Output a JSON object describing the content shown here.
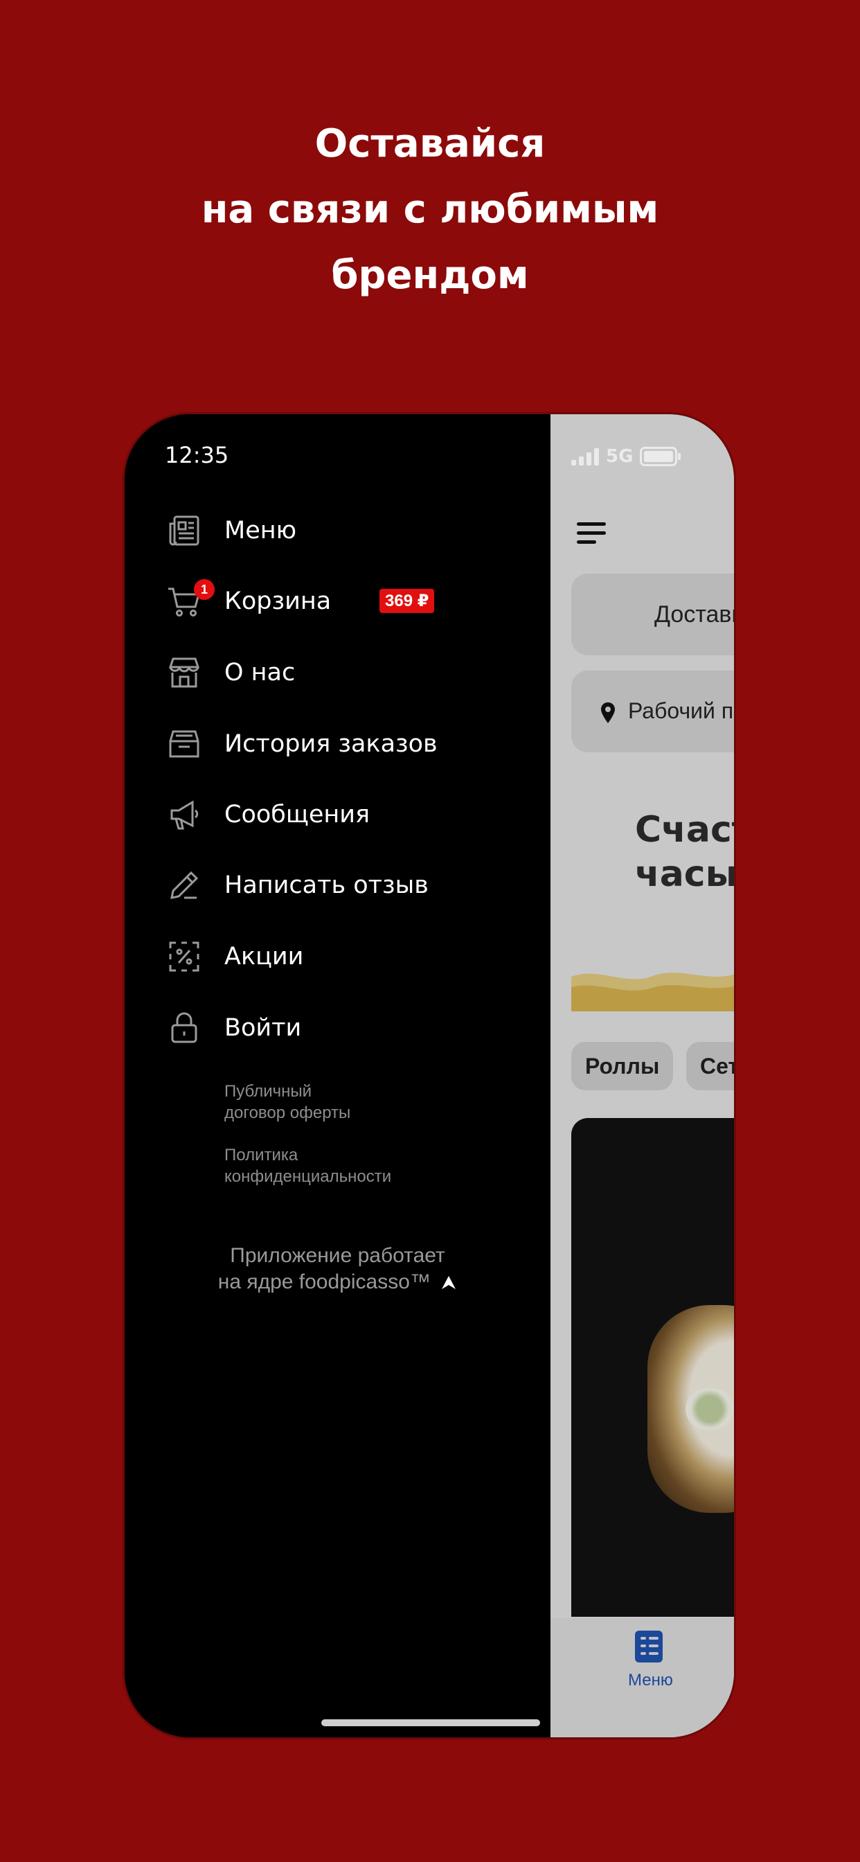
{
  "headline": {
    "line1": "Оставайся",
    "line2": "на связи с любимым",
    "line3": "брендом"
  },
  "status_bar": {
    "time": "12:35",
    "network": "5G"
  },
  "drawer": {
    "items": [
      {
        "label": "Меню",
        "icon": "newspaper-icon"
      },
      {
        "label": "Корзина",
        "icon": "cart-icon",
        "badge_count": "1",
        "price": "369 ₽"
      },
      {
        "label": "О нас",
        "icon": "store-icon"
      },
      {
        "label": "История заказов",
        "icon": "archive-icon"
      },
      {
        "label": "Сообщения",
        "icon": "megaphone-icon"
      },
      {
        "label": "Написать отзыв",
        "icon": "pencil-icon"
      },
      {
        "label": "Акции",
        "icon": "discount-icon"
      },
      {
        "label": "Войти",
        "icon": "lock-icon"
      }
    ],
    "legal": {
      "offer_line1": "Публичный",
      "offer_line2": "договор оферты",
      "privacy_line1": "Политика",
      "privacy_line2": "конфиденциальности"
    },
    "powered": {
      "line1": "Приложение работает",
      "line2": "на ядре foodpicasso™"
    }
  },
  "app": {
    "delivery_label": "Доставка",
    "address_label": "Рабочий поселок",
    "promo_title_line1": "Счастливые",
    "promo_title_line2": "часы",
    "chips": [
      "Роллы",
      "Сеты"
    ],
    "bottom_nav": {
      "menu_label": "Меню"
    }
  },
  "colors": {
    "background": "#8c0a0a",
    "badge_red": "#e10f0f",
    "nav_blue": "#1f4fa8"
  }
}
